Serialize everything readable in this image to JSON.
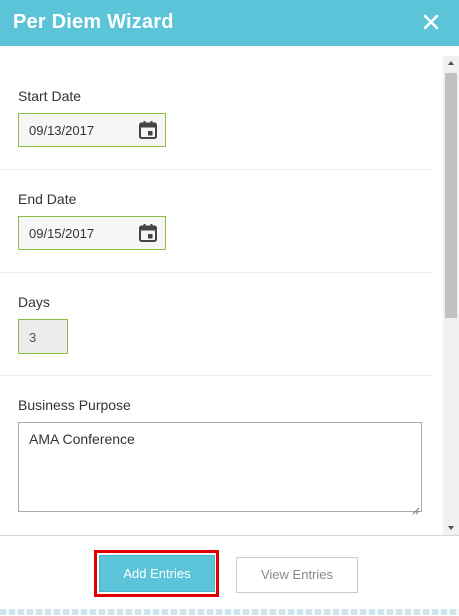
{
  "dialog": {
    "title": "Per Diem Wizard",
    "close_icon": "close-icon"
  },
  "form": {
    "start_date": {
      "label": "Start Date",
      "value": "09/13/2017",
      "icon": "calendar-icon"
    },
    "end_date": {
      "label": "End Date",
      "value": "09/15/2017",
      "icon": "calendar-icon"
    },
    "days": {
      "label": "Days",
      "value": "3"
    },
    "business_purpose": {
      "label": "Business Purpose",
      "value": "AMA Conference"
    }
  },
  "footer": {
    "add_entries_label": "Add Entries",
    "view_entries_label": "View Entries"
  },
  "colors": {
    "header": "#5bc4d8",
    "field_border": "#8dbd3f",
    "highlight": "#e00000"
  }
}
